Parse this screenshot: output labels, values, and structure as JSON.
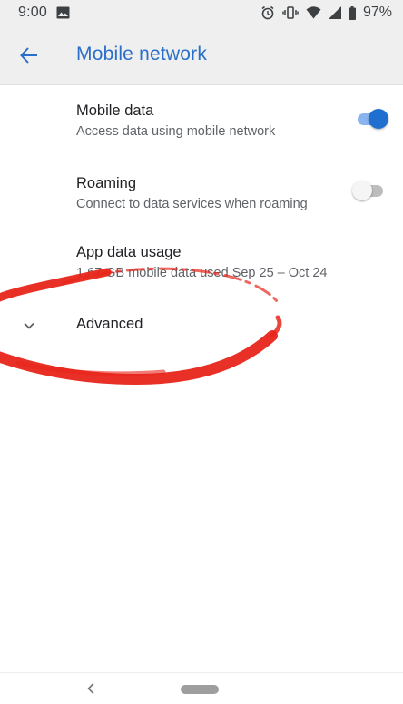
{
  "status_bar": {
    "time": "9:00",
    "battery": "97%",
    "icons": [
      "image-icon",
      "alarm-icon",
      "vibrate-icon",
      "wifi-icon",
      "signal-icon",
      "battery-icon"
    ]
  },
  "app_bar": {
    "title": "Mobile network",
    "back_icon": "arrow-back-icon"
  },
  "settings": {
    "mobile_data": {
      "title": "Mobile data",
      "summary": "Access data using mobile network",
      "enabled": true
    },
    "roaming": {
      "title": "Roaming",
      "summary": "Connect to data services when roaming",
      "enabled": false
    },
    "app_data_usage": {
      "title": "App data usage",
      "summary": "1.67 GB mobile data used Sep 25 – Oct 24"
    },
    "advanced": {
      "title": "Advanced",
      "icon": "chevron-down-icon"
    }
  },
  "colors": {
    "accent": "#2a6fc9",
    "toggle_on_thumb": "#1f6fd0",
    "toggle_on_track": "#8ab4f0",
    "annotation": "#e8251a"
  },
  "nav_bar": {
    "icons": [
      "nav-back-icon",
      "home-pill-icon"
    ]
  }
}
